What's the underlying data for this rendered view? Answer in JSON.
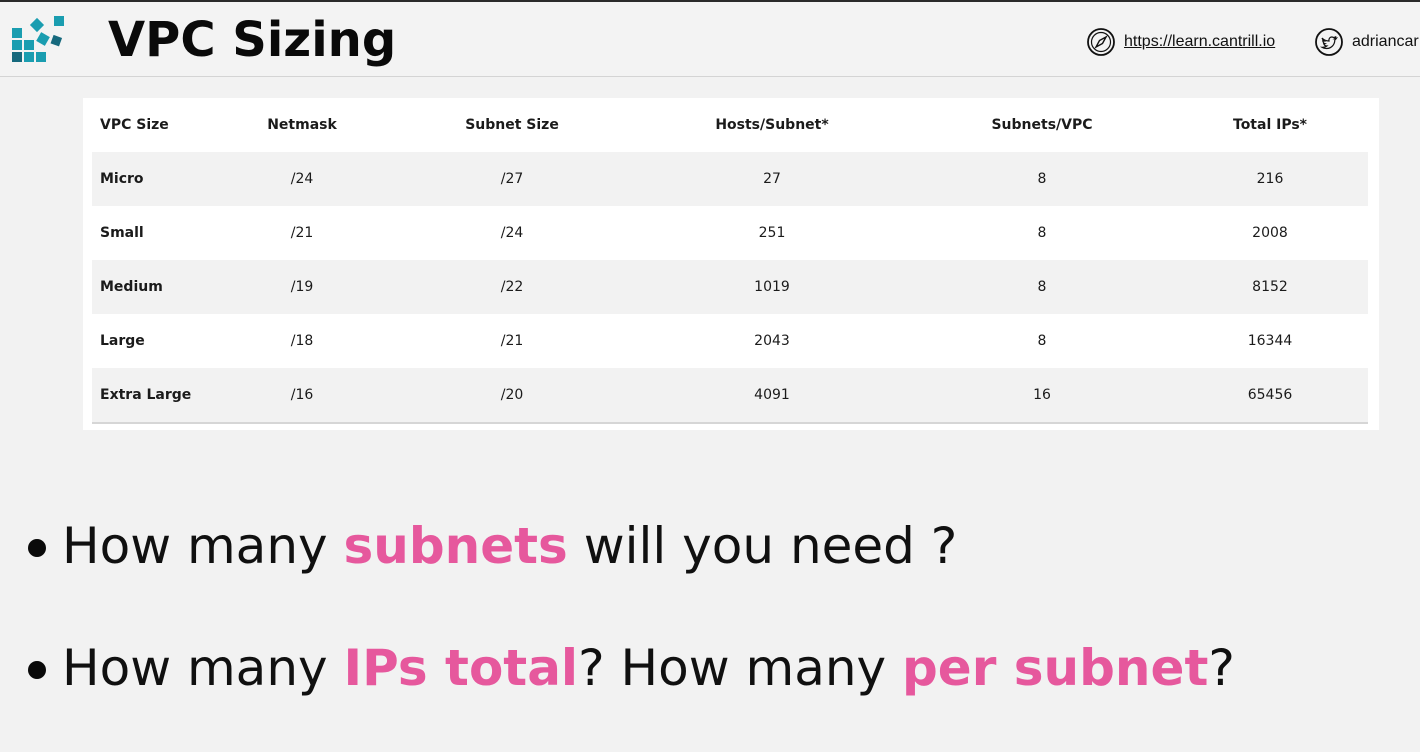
{
  "header": {
    "title": "VPC Sizing",
    "site_link": "https://learn.cantrill.io",
    "twitter_handle": "adriancar",
    "site_icon": "compass-icon",
    "twitter_icon": "twitter-bird-icon",
    "logo_icon": "blocks-logo-icon"
  },
  "table": {
    "headers": [
      "VPC Size",
      "Netmask",
      "Subnet Size",
      "Hosts/Subnet*",
      "Subnets/VPC",
      "Total IPs*"
    ],
    "rows": [
      [
        "Micro",
        "/24",
        "/27",
        "27",
        "8",
        "216"
      ],
      [
        "Small",
        "/21",
        "/24",
        "251",
        "8",
        "2008"
      ],
      [
        "Medium",
        "/19",
        "/22",
        "1019",
        "8",
        "8152"
      ],
      [
        "Large",
        "/18",
        "/21",
        "2043",
        "8",
        "16344"
      ],
      [
        "Extra Large",
        "/16",
        "/20",
        "4091",
        "16",
        "65456"
      ]
    ]
  },
  "bullets": [
    {
      "parts": [
        {
          "text": "How many ",
          "highlight": false
        },
        {
          "text": "subnets",
          "highlight": true
        },
        {
          "text": " will you need ?",
          "highlight": false
        }
      ]
    },
    {
      "parts": [
        {
          "text": "How many ",
          "highlight": false
        },
        {
          "text": "IPs total",
          "highlight": true
        },
        {
          "text": "? How many ",
          "highlight": false
        },
        {
          "text": "per subnet",
          "highlight": true
        },
        {
          "text": "?",
          "highlight": false
        }
      ]
    }
  ],
  "colors": {
    "highlight": "#e6589d",
    "background": "#f2f2f2",
    "logo_teal": "#1a9db0",
    "logo_dark": "#16697d"
  }
}
